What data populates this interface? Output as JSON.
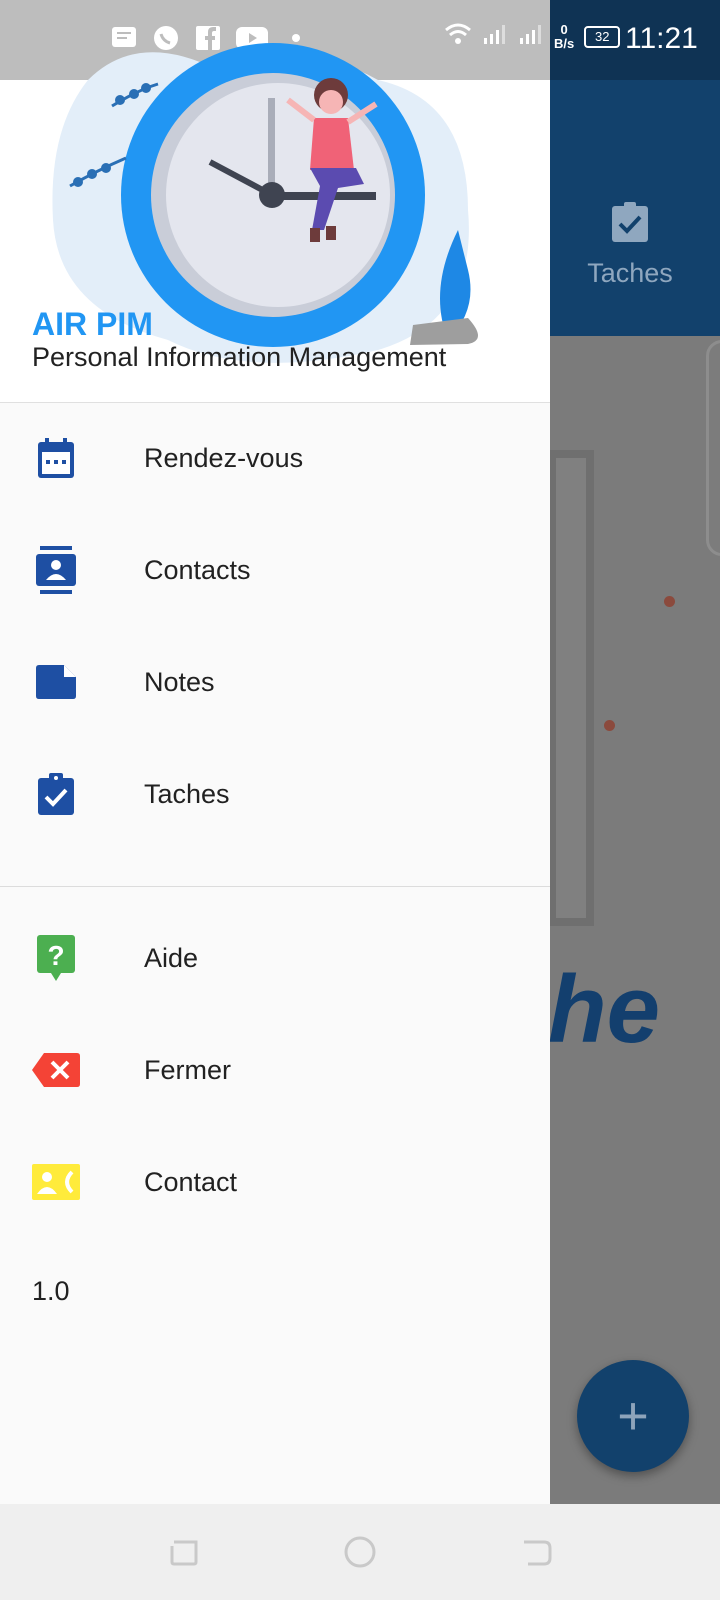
{
  "status_bar": {
    "time": "11:21",
    "net_speed_value": "0",
    "net_speed_unit": "B/s",
    "battery": "32",
    "notification_icons": [
      "message-icon",
      "whatsapp-icon",
      "facebook-icon",
      "youtube-icon",
      "dot-icon"
    ],
    "system_icons": [
      "wifi-icon",
      "signal-icon",
      "signal-icon"
    ]
  },
  "background_app": {
    "tab_label": "Taches",
    "partial_text": "he",
    "fab_label": "+"
  },
  "drawer": {
    "app_name": "AIR PIM",
    "app_subtitle": "Personal Information Management",
    "primary_items": [
      {
        "label": "Rendez-vous",
        "icon": "calendar-icon",
        "color": "#1e4fa3"
      },
      {
        "label": "Contacts",
        "icon": "contacts-icon",
        "color": "#1e4fa3"
      },
      {
        "label": "Notes",
        "icon": "note-icon",
        "color": "#1e4fa3"
      },
      {
        "label": "Taches",
        "icon": "task-icon",
        "color": "#1e4fa3"
      }
    ],
    "secondary_items": [
      {
        "label": "Aide",
        "icon": "help-icon",
        "color": "#4caf50"
      },
      {
        "label": "Fermer",
        "icon": "close-icon",
        "color": "#f44336"
      },
      {
        "label": "Contact",
        "icon": "contact-phone-icon",
        "color": "#ffeb3b"
      }
    ],
    "version": "1.0"
  },
  "colors": {
    "accent": "#2196f3",
    "header_bg": "#12416c",
    "icon_blue": "#1e4fa3"
  }
}
